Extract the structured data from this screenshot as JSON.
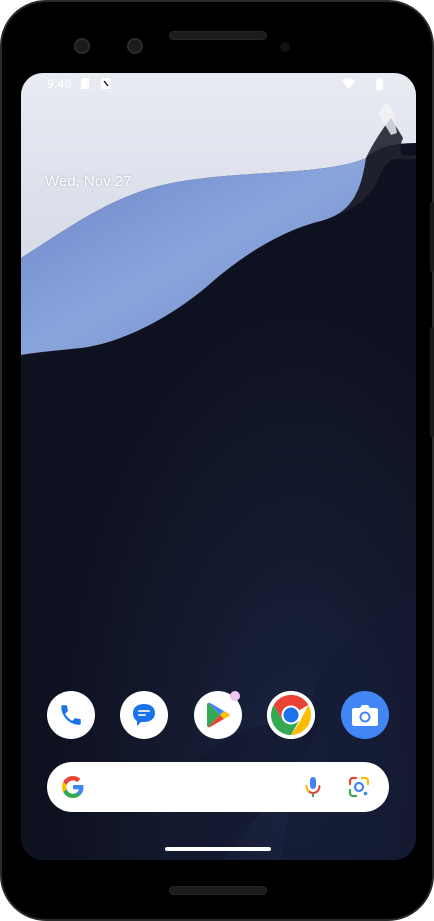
{
  "status_bar": {
    "time": "9:40",
    "left_icons": [
      "sim-card-icon",
      "notification-icon"
    ],
    "right_icons": [
      "wifi-icon",
      "battery-icon"
    ]
  },
  "home": {
    "date": "Wed, Nov 27"
  },
  "dock": {
    "apps": [
      {
        "name": "Phone",
        "icon": "phone-icon"
      },
      {
        "name": "Messages",
        "icon": "messages-icon"
      },
      {
        "name": "Play Store",
        "icon": "play-store-icon",
        "has_badge": true
      },
      {
        "name": "Chrome",
        "icon": "chrome-icon"
      },
      {
        "name": "Camera",
        "icon": "camera-icon"
      }
    ]
  },
  "search": {
    "placeholder": "",
    "icons": [
      "google-g-icon",
      "microphone-icon",
      "google-lens-icon"
    ]
  },
  "colors": {
    "wallpaper_dark": "#0e1120",
    "wallpaper_light": "#e6e8f0",
    "wallpaper_blue": "#7b95d0",
    "google_blue": "#4285f4",
    "google_red": "#ea4335",
    "google_yellow": "#fbbc05",
    "google_green": "#34a853"
  }
}
